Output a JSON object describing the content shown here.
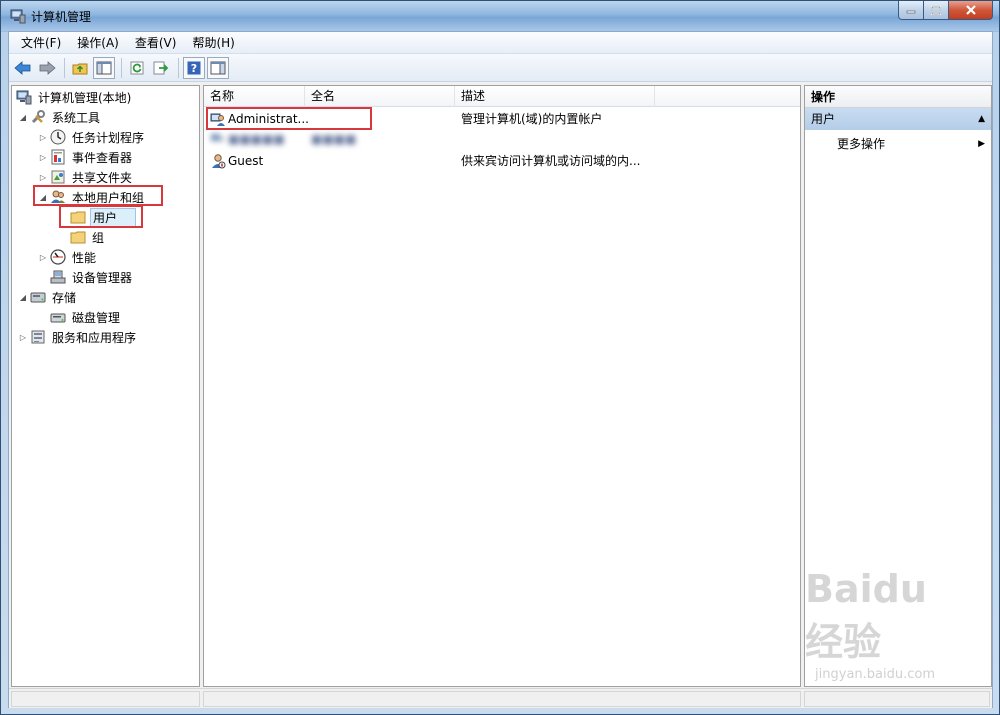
{
  "window": {
    "title": "计算机管理"
  },
  "menu": [
    "文件(F)",
    "操作(A)",
    "查看(V)",
    "帮助(H)"
  ],
  "toolbar": [
    "back-icon",
    "forward-icon",
    "up-folder-icon",
    "show-hide-tree-icon",
    "refresh-icon",
    "export-icon",
    "help-icon",
    "show-hide-action-icon"
  ],
  "tree": {
    "root": "计算机管理(本地)",
    "items": [
      {
        "label": "系统工具",
        "arrow": "◢",
        "level": 1
      },
      {
        "label": "任务计划程序",
        "arrow": "▷",
        "level": 2
      },
      {
        "label": "事件查看器",
        "arrow": "▷",
        "level": 2
      },
      {
        "label": "共享文件夹",
        "arrow": "▷",
        "level": 2
      },
      {
        "label": "本地用户和组",
        "arrow": "◢",
        "level": 2
      },
      {
        "label": "用户",
        "arrow": "",
        "level": 3
      },
      {
        "label": "组",
        "arrow": "",
        "level": 3
      },
      {
        "label": "性能",
        "arrow": "▷",
        "level": 2
      },
      {
        "label": "设备管理器",
        "arrow": "",
        "level": 2
      },
      {
        "label": "存储",
        "arrow": "◢",
        "level": 1
      },
      {
        "label": "磁盘管理",
        "arrow": "",
        "level": 2
      },
      {
        "label": "服务和应用程序",
        "arrow": "▷",
        "level": 1
      }
    ]
  },
  "list": {
    "columns": [
      "名称",
      "全名",
      "描述"
    ],
    "rows": [
      {
        "name": "Administrat...",
        "fullname": "",
        "desc": "管理计算机(域)的内置帐户",
        "blurred": false
      },
      {
        "name": "■■■■■",
        "fullname": "■■■■",
        "desc": "",
        "blurred": true
      },
      {
        "name": "Guest",
        "fullname": "",
        "desc": "供来宾访问计算机或访问域的内...",
        "blurred": false
      }
    ]
  },
  "actions": {
    "header": "操作",
    "section": "用户",
    "items": [
      "更多操作"
    ]
  },
  "watermark": {
    "main": "Baidu经验",
    "sub": "jingyan.baidu.com"
  },
  "colors": {
    "highlight": "#d6383c",
    "section": "#b4cde8"
  }
}
